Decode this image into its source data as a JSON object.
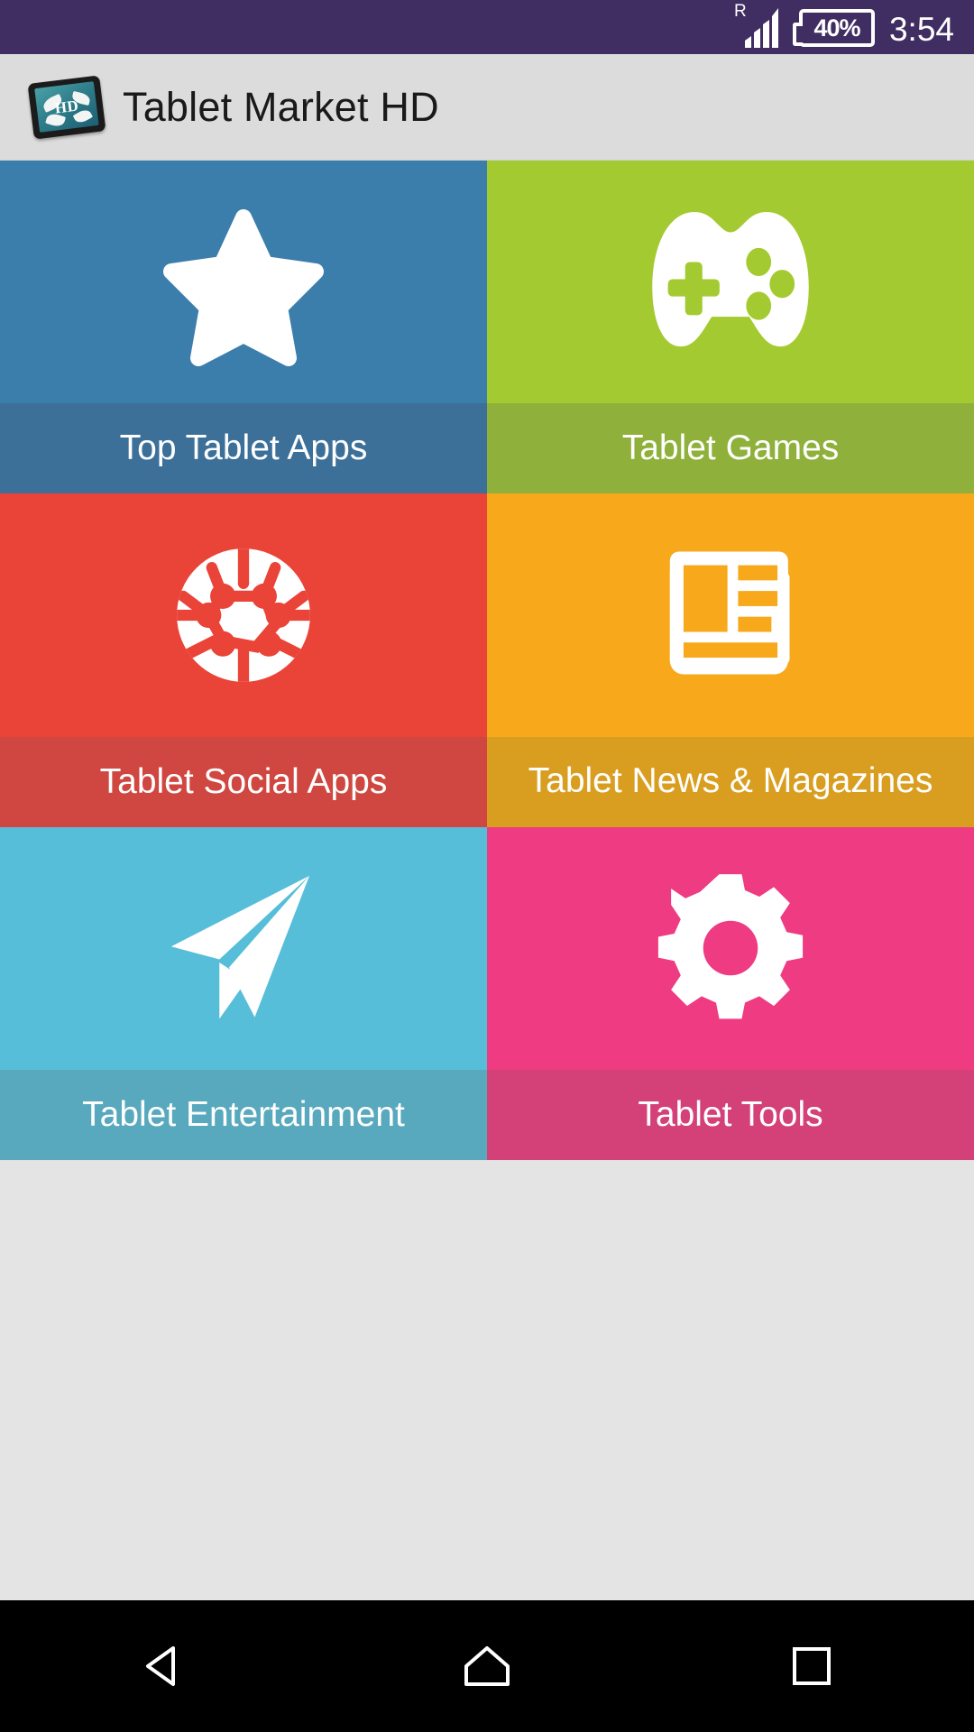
{
  "status_bar": {
    "roaming_indicator": "R",
    "signal_icon": "signal-bars-icon",
    "battery_text": "40%",
    "time": "3:54",
    "background_color": "#402e62"
  },
  "app_bar": {
    "icon": "tablet-hd-app-icon",
    "icon_screen_text": "HD",
    "title": "Tablet Market HD",
    "background_color": "#dcdcdc"
  },
  "grid": {
    "tiles": [
      {
        "id": "top-tablet-apps",
        "label": "Top Tablet Apps",
        "icon": "star-icon",
        "color": "#3b7eab",
        "label_color": "#3c7099"
      },
      {
        "id": "tablet-games",
        "label": "Tablet Games",
        "icon": "gamepad-icon",
        "color": "#a4ca31",
        "label_color": "#8fb03a"
      },
      {
        "id": "tablet-social-apps",
        "label": "Tablet Social Apps",
        "icon": "social-network-globe-icon",
        "color": "#ea4337",
        "label_color": "#cf4740"
      },
      {
        "id": "tablet-news-magazines",
        "label": "Tablet News & Magazines",
        "icon": "newspaper-icon",
        "color": "#f7a81b",
        "label_color": "#d99e20"
      },
      {
        "id": "tablet-entertainment",
        "label": "Tablet Entertainment",
        "icon": "paper-plane-icon",
        "color": "#56bed8",
        "label_color": "#58a9bd"
      },
      {
        "id": "tablet-tools",
        "label": "Tablet Tools",
        "icon": "gear-icon",
        "color": "#ef3b81",
        "label_color": "#d34178"
      }
    ]
  },
  "nav_bar": {
    "background_color": "#000000",
    "back_label": "back-icon",
    "home_label": "home-icon",
    "recents_label": "recents-icon"
  }
}
